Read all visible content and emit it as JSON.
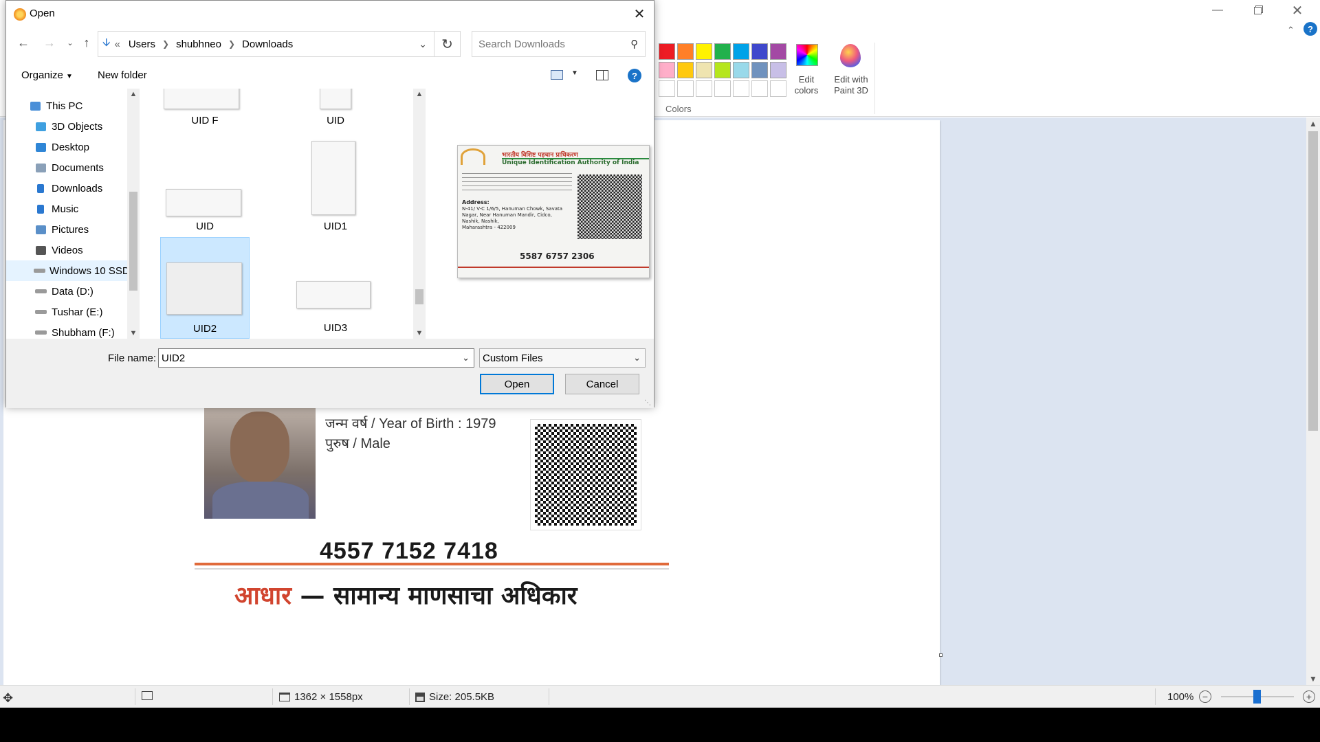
{
  "dialog": {
    "title": "Open",
    "nav": {
      "breadcrumb_overflow": "«",
      "breadcrumb": [
        "Users",
        "shubhneo",
        "Downloads"
      ],
      "search_placeholder": "Search Downloads"
    },
    "toolbar": {
      "organize": "Organize",
      "new_folder": "New folder"
    },
    "tree": [
      {
        "label": "This PC",
        "icon": "computer-icon"
      },
      {
        "label": "3D Objects",
        "icon": "cube-icon"
      },
      {
        "label": "Desktop",
        "icon": "desktop-icon"
      },
      {
        "label": "Documents",
        "icon": "document-icon"
      },
      {
        "label": "Downloads",
        "icon": "download-icon"
      },
      {
        "label": "Music",
        "icon": "music-icon"
      },
      {
        "label": "Pictures",
        "icon": "picture-icon"
      },
      {
        "label": "Videos",
        "icon": "video-icon"
      },
      {
        "label": "Windows 10 SSD",
        "icon": "drive-icon"
      },
      {
        "label": "Data (D:)",
        "icon": "drive-icon"
      },
      {
        "label": "Tushar (E:)",
        "icon": "drive-icon"
      },
      {
        "label": "Shubham (F:)",
        "icon": "drive-icon"
      }
    ],
    "files": [
      {
        "name": "UID F"
      },
      {
        "name": "UID"
      },
      {
        "name": "UID"
      },
      {
        "name": "UID1"
      },
      {
        "name": "UID2",
        "selected": true
      },
      {
        "name": "UID3"
      }
    ],
    "preview": {
      "header_hindi": "भारतीय विशिष्ट पहचान प्राधिकरण",
      "header_english": "Unique Identification Authority of India",
      "address_label": "Address:",
      "address_lines": [
        "N-41/ V-C 1/6/5, Hanuman Chowk, Savata",
        "Nagar, Near Hanuman Mandir, Cidco,",
        "Nashik, Nashik,",
        "Maharashtra - 422009"
      ],
      "number": "5587 6757 2306"
    },
    "file_name_label": "File name:",
    "file_name_value": "UID2",
    "file_type": "Custom Files",
    "open_button": "Open",
    "cancel_button": "Cancel"
  },
  "paint": {
    "colors_label": "Colors",
    "edit_colors": "Edit colors",
    "edit_paint3d": "Edit with Paint 3D",
    "palette_row1": [
      "#ed1c24",
      "#ff7f27",
      "#fff200",
      "#22b14c",
      "#00a2e8",
      "#3f48cc",
      "#a349a4"
    ],
    "palette_row2": [
      "#ffaec9",
      "#ffc90e",
      "#efe4b0",
      "#b5e61d",
      "#99d9ea",
      "#7092be",
      "#c8bfe7"
    ],
    "card": {
      "year_of_birth": "जन्म वर्ष / Year of Birth : 1979",
      "gender": "पुरुष / Male",
      "number": "4557 7152 7418",
      "tagline_red": "आधार",
      "tagline_rest": " — सामान्य माणसाचा अधिकार"
    },
    "status": {
      "dimensions": "1362 × 1558px",
      "size": "Size: 205.5KB",
      "zoom": "100%"
    }
  }
}
